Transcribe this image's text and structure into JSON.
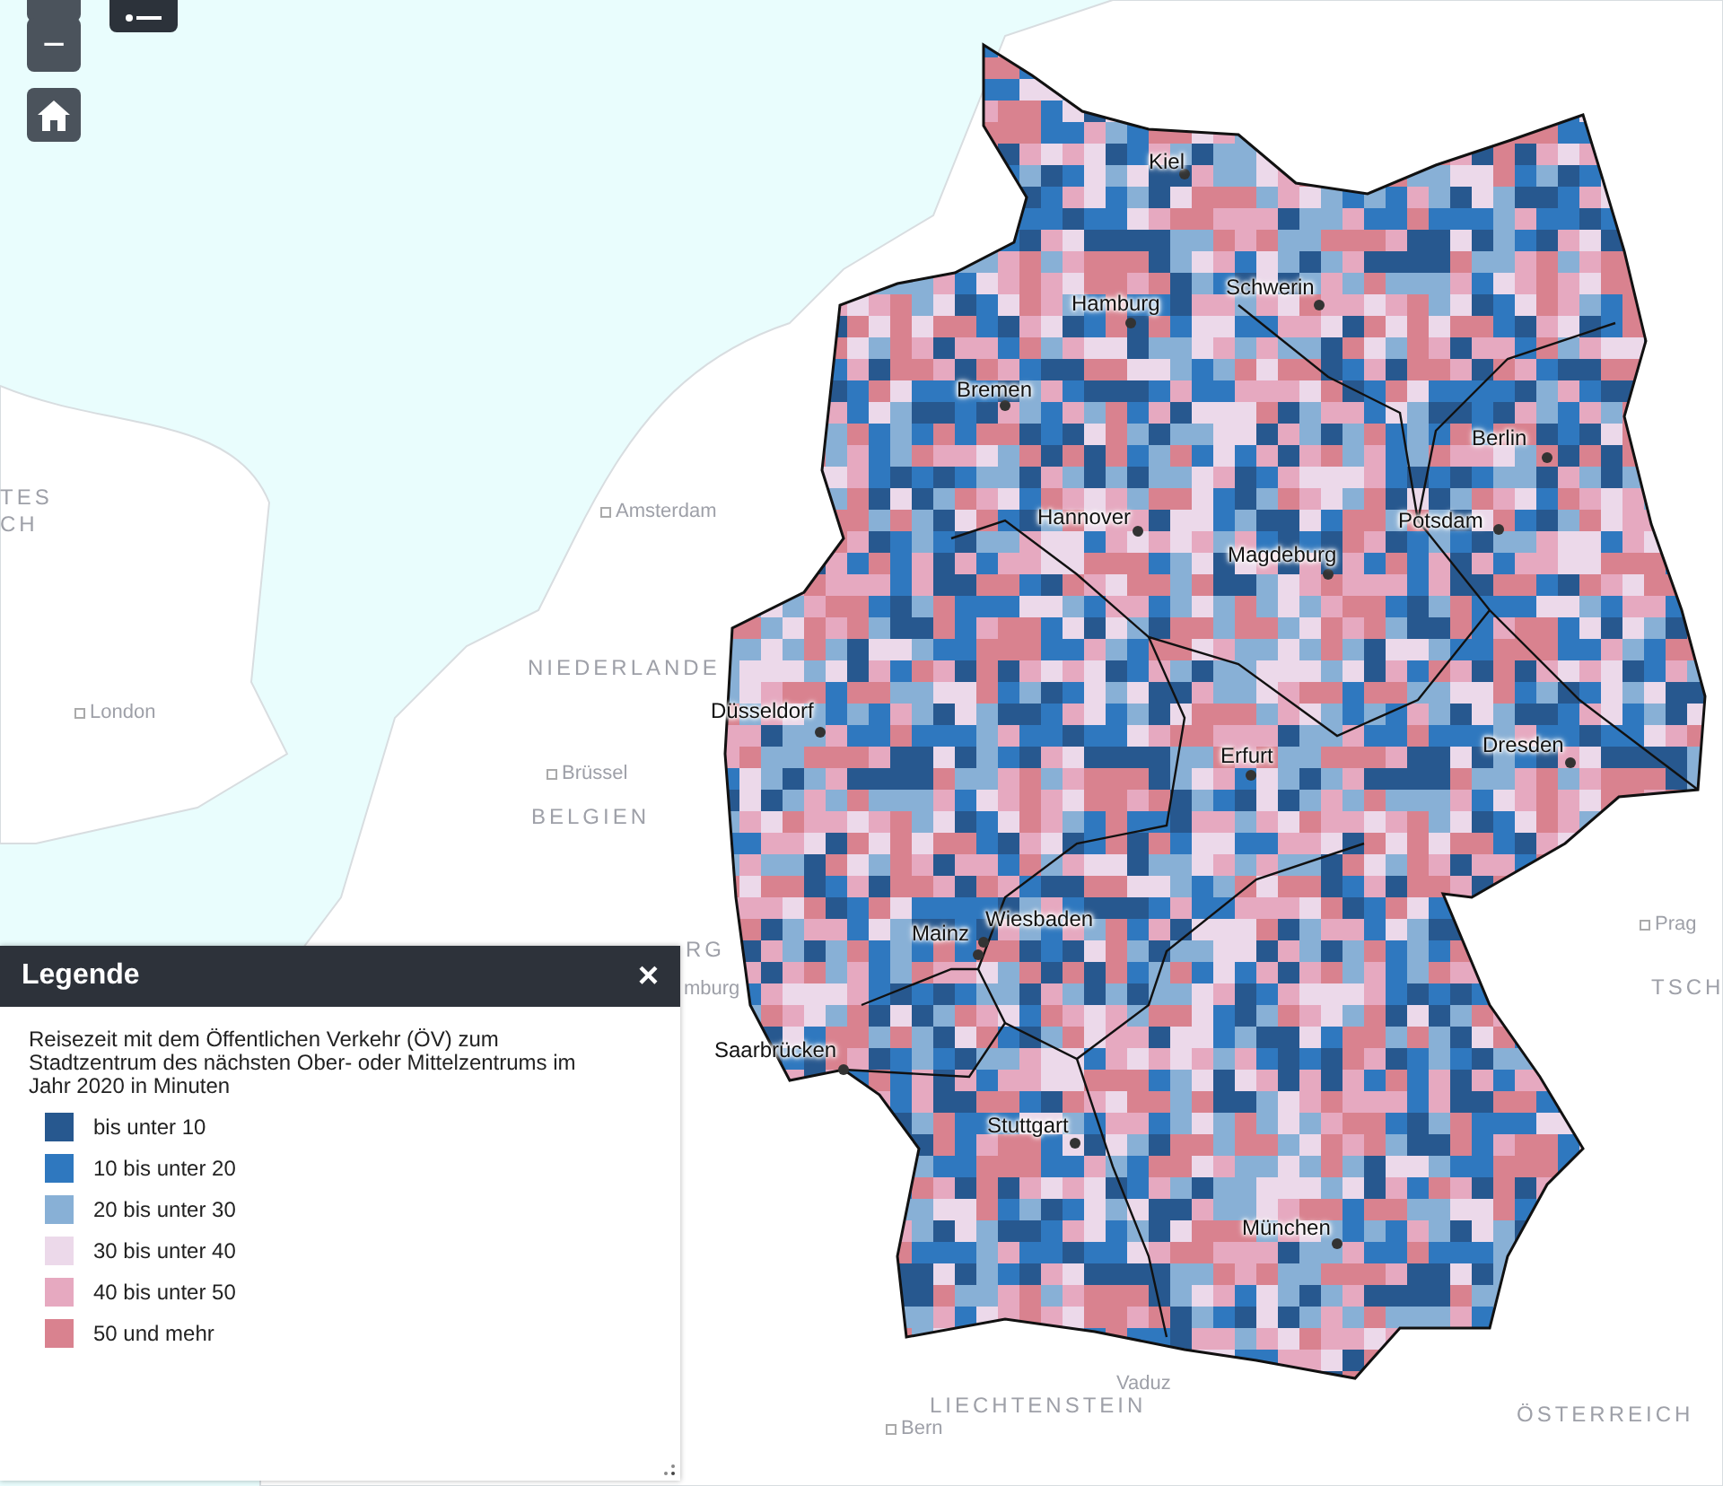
{
  "map_controls": {
    "zoom_out": "−"
  },
  "legend": {
    "title": "Legende",
    "close": "×",
    "description": "Reisezeit mit dem Öffentlichen Verkehr (ÖV) zum Stadtzentrum des nächsten Ober- oder Mittelzentrums im Jahr 2020 in Minuten",
    "items": [
      {
        "label": "bis unter 10",
        "color": "#27588f"
      },
      {
        "label": "10 bis unter 20",
        "color": "#2f78bf"
      },
      {
        "label": "20 bis unter 30",
        "color": "#88b0d6"
      },
      {
        "label": "30 bis unter 40",
        "color": "#ecd9ea"
      },
      {
        "label": "40 bis unter 50",
        "color": "#e6a9c0"
      },
      {
        "label": "50 und mehr",
        "color": "#d9828f"
      }
    ]
  },
  "map_labels": [
    {
      "text": "Kiel",
      "kind": "city"
    },
    {
      "text": "Hamburg",
      "kind": "city"
    },
    {
      "text": "Schwerin",
      "kind": "city"
    },
    {
      "text": "Bremen",
      "kind": "city"
    },
    {
      "text": "Hannover",
      "kind": "city"
    },
    {
      "text": "Berlin",
      "kind": "city"
    },
    {
      "text": "Potsdam",
      "kind": "city"
    },
    {
      "text": "Magdeburg",
      "kind": "city"
    },
    {
      "text": "Düsseldorf",
      "kind": "city"
    },
    {
      "text": "Erfurt",
      "kind": "city"
    },
    {
      "text": "Dresden",
      "kind": "city"
    },
    {
      "text": "Wiesbaden",
      "kind": "city"
    },
    {
      "text": "Mainz",
      "kind": "city"
    },
    {
      "text": "Saarbrücken",
      "kind": "city"
    },
    {
      "text": "Stuttgart",
      "kind": "city"
    },
    {
      "text": "München",
      "kind": "city"
    },
    {
      "text": "Amsterdam",
      "kind": "place"
    },
    {
      "text": "London",
      "kind": "place"
    },
    {
      "text": "Brüssel",
      "kind": "place"
    },
    {
      "text": "Prag",
      "kind": "place"
    },
    {
      "text": "Vaduz",
      "kind": "town"
    },
    {
      "text": "Bern",
      "kind": "place"
    },
    {
      "text": "TES",
      "kind": "country"
    },
    {
      "text": "CH",
      "kind": "country"
    },
    {
      "text": "NIEDERLANDE",
      "kind": "country"
    },
    {
      "text": "BELGIEN",
      "kind": "country"
    },
    {
      "text": "RG",
      "kind": "country"
    },
    {
      "text": "mburg",
      "kind": "place"
    },
    {
      "text": "TSCH",
      "kind": "country"
    },
    {
      "text": "LIECHTENSTEIN",
      "kind": "country"
    },
    {
      "text": "ÖSTERREICH",
      "kind": "country"
    }
  ]
}
